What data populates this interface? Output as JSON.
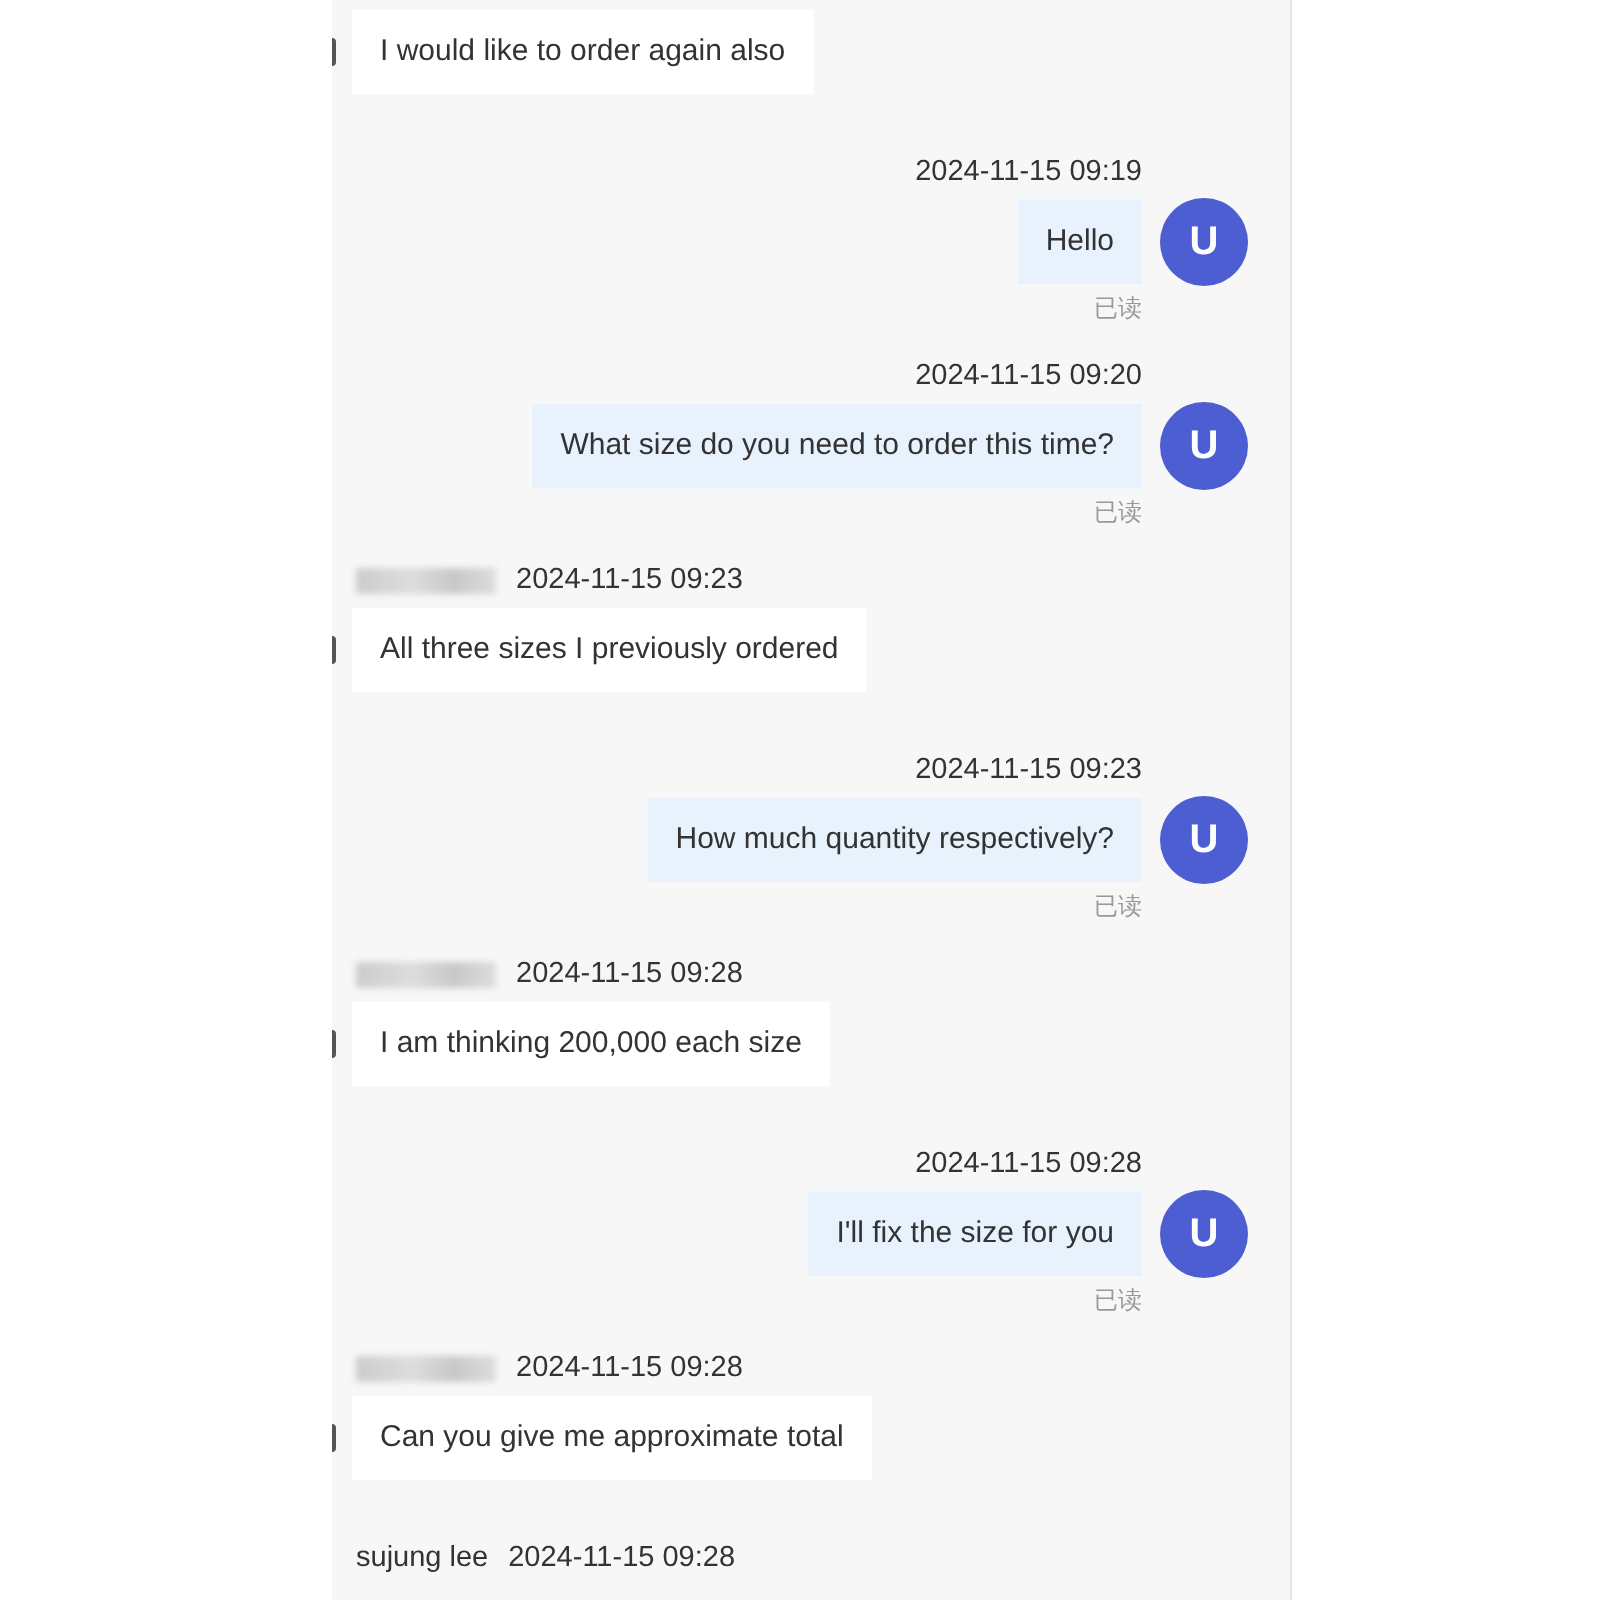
{
  "messages": [
    {
      "kind": "in",
      "text": "I would like to order again also"
    },
    {
      "kind": "out",
      "time": "2024-11-15 09:19",
      "text": "Hello",
      "avatar": "U",
      "status": "已读"
    },
    {
      "kind": "out",
      "time": "2024-11-15 09:20",
      "text": "What size do you need to order this time?",
      "avatar": "U",
      "status": "已读"
    },
    {
      "kind": "in",
      "name_hidden": true,
      "time": "2024-11-15 09:23",
      "text": "All three sizes I previously ordered"
    },
    {
      "kind": "out",
      "time": "2024-11-15 09:23",
      "text": "How much quantity respectively?",
      "avatar": "U",
      "status": "已读"
    },
    {
      "kind": "in",
      "name_hidden": true,
      "time": "2024-11-15 09:28",
      "text": "I am thinking 200,000 each size"
    },
    {
      "kind": "out",
      "time": "2024-11-15 09:28",
      "text": "I'll fix the size for you",
      "avatar": "U",
      "status": "已读"
    },
    {
      "kind": "in",
      "name_hidden": true,
      "time": "2024-11-15 09:28",
      "text": "Can you give me approximate total"
    },
    {
      "kind": "in",
      "sender": "sujung lee",
      "time": "2024-11-15 09:28"
    }
  ]
}
